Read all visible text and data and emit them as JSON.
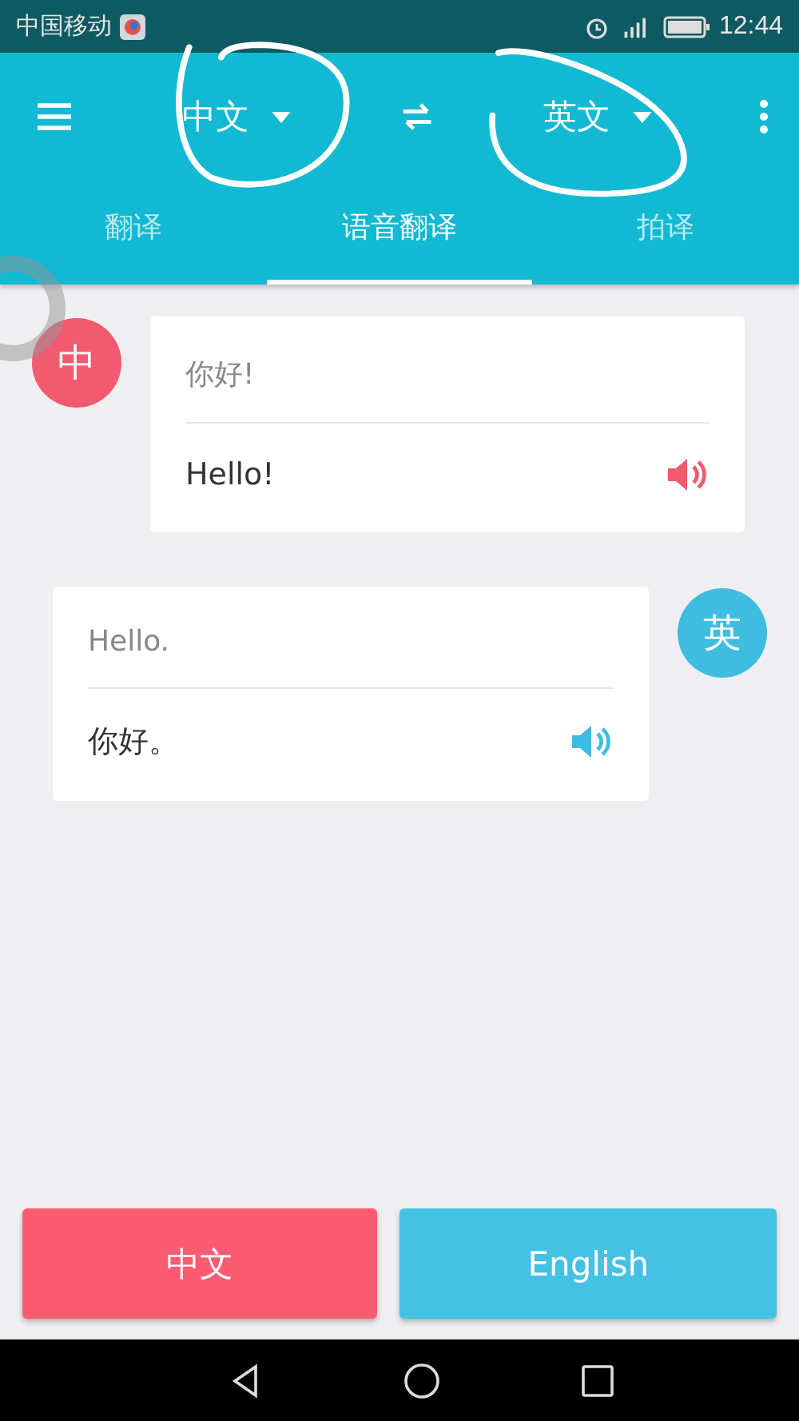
{
  "status_bar": {
    "carrier": "中国移动",
    "time": "12:44"
  },
  "header": {
    "source_language": "中文",
    "target_language": "英文"
  },
  "tabs": [
    {
      "label": "翻译",
      "selected": false
    },
    {
      "label": "语音翻译",
      "selected": true
    },
    {
      "label": "拍译",
      "selected": false
    }
  ],
  "messages": [
    {
      "kind": "left",
      "avatar": "中",
      "color": "#f25a70",
      "original": "你好!",
      "translation": "Hello!"
    },
    {
      "kind": "right",
      "avatar": "英",
      "color": "#3fbde0",
      "original": "Hello.",
      "translation": "你好。"
    }
  ],
  "buttons": [
    {
      "label": "中文",
      "color": "#fc5c72"
    },
    {
      "label": "English",
      "color": "#44c2e4"
    }
  ]
}
